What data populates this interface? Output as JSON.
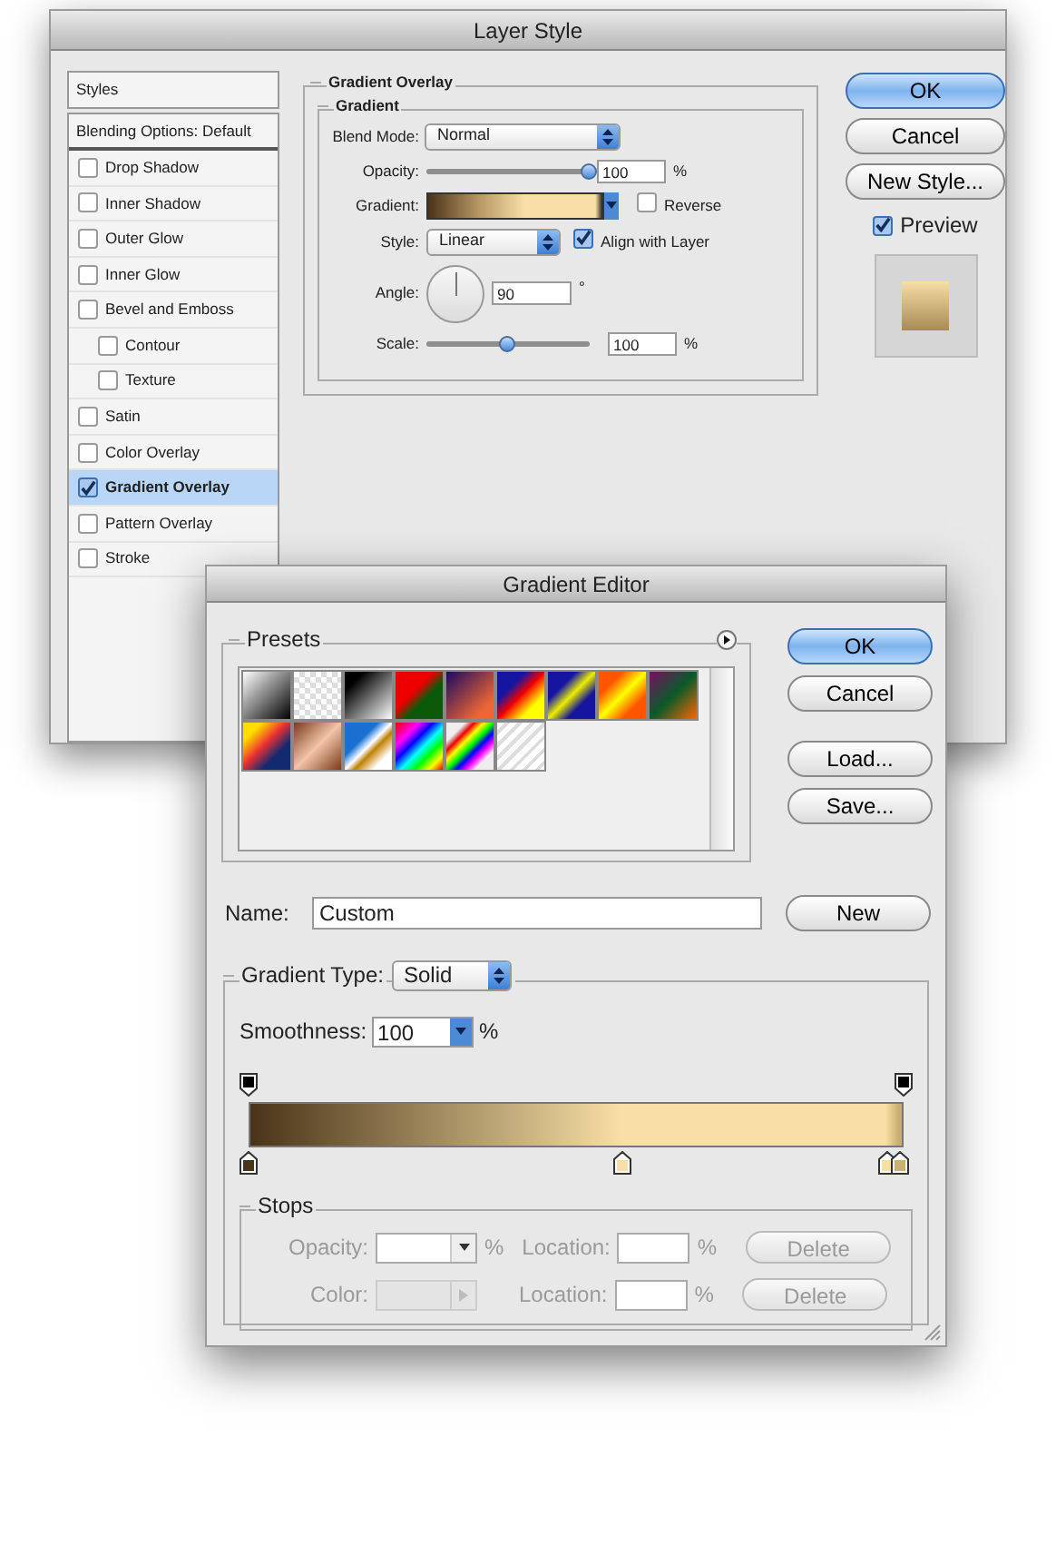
{
  "layer_style": {
    "title": "Layer Style",
    "styles_header": "Styles",
    "blending_options": "Blending Options: Default",
    "effects": [
      {
        "label": "Drop Shadow",
        "checked": false,
        "selected": false
      },
      {
        "label": "Inner Shadow",
        "checked": false,
        "selected": false
      },
      {
        "label": "Outer Glow",
        "checked": false,
        "selected": false
      },
      {
        "label": "Inner Glow",
        "checked": false,
        "selected": false
      },
      {
        "label": "Bevel and Emboss",
        "checked": false,
        "selected": false,
        "children": [
          {
            "label": "Contour",
            "checked": false,
            "selected": false
          },
          {
            "label": "Texture",
            "checked": false,
            "selected": false
          }
        ]
      },
      {
        "label": "Satin",
        "checked": false,
        "selected": false
      },
      {
        "label": "Color Overlay",
        "checked": false,
        "selected": false
      },
      {
        "label": "Gradient Overlay",
        "checked": true,
        "selected": true
      },
      {
        "label": "Pattern Overlay",
        "checked": false,
        "selected": false
      },
      {
        "label": "Stroke",
        "checked": false,
        "selected": false
      }
    ],
    "section_title": "Gradient Overlay",
    "group_title": "Gradient",
    "blend_mode": {
      "label": "Blend Mode:",
      "value": "Normal"
    },
    "opacity": {
      "label": "Opacity:",
      "value": "100",
      "unit": "%",
      "level": 1.0
    },
    "gradient": {
      "label": "Gradient:"
    },
    "reverse": {
      "label": "Reverse",
      "checked": false
    },
    "style": {
      "label": "Style:",
      "value": "Linear"
    },
    "align_with_layer": {
      "label": "Align with Layer",
      "checked": true
    },
    "angle": {
      "label": "Angle:",
      "value": "90",
      "unit": "°"
    },
    "scale": {
      "label": "Scale:",
      "value": "100",
      "unit": "%",
      "level": 0.5
    },
    "buttons": [
      {
        "label": "OK",
        "default": true
      },
      {
        "label": "Cancel",
        "default": false
      },
      {
        "label": "New Style...",
        "default": false
      }
    ],
    "preview": {
      "label": "Preview",
      "checked": true
    }
  },
  "gradient_editor": {
    "title": "Gradient Editor",
    "presets_label": "Presets",
    "buttons": [
      {
        "label": "OK",
        "default": true
      },
      {
        "label": "Cancel",
        "default": false
      },
      {
        "label": "Load...",
        "default": false
      },
      {
        "label": "Save...",
        "default": false
      }
    ],
    "name": {
      "label": "Name:",
      "value": "Custom"
    },
    "new_button": "New",
    "gradient_type": {
      "label": "Gradient Type:",
      "value": "Solid"
    },
    "smoothness": {
      "label": "Smoothness:",
      "value": "100",
      "unit": "%"
    },
    "opacity_stops": [
      {
        "level": 0,
        "color": "#000000"
      },
      {
        "level": 1,
        "color": "#000000"
      }
    ],
    "color_stops": [
      {
        "level": 0,
        "color": "#4a3418"
      },
      {
        "level": 0.57,
        "color": "#f7dfa5"
      },
      {
        "level": 0.975,
        "color": "#f7dfa5"
      },
      {
        "level": 0.995,
        "color": "#c8b071"
      }
    ],
    "stops": {
      "label": "Stops",
      "rows": [
        {
          "label": "Opacity:",
          "kind": "dropdown",
          "unit": "%",
          "location_label": "Location:",
          "location_unit": "%",
          "delete": "Delete",
          "disabled": true
        },
        {
          "label": "Color:",
          "kind": "swatch",
          "unit": "",
          "location_label": "Location:",
          "location_unit": "%",
          "delete": "Delete",
          "disabled": true
        }
      ]
    }
  }
}
